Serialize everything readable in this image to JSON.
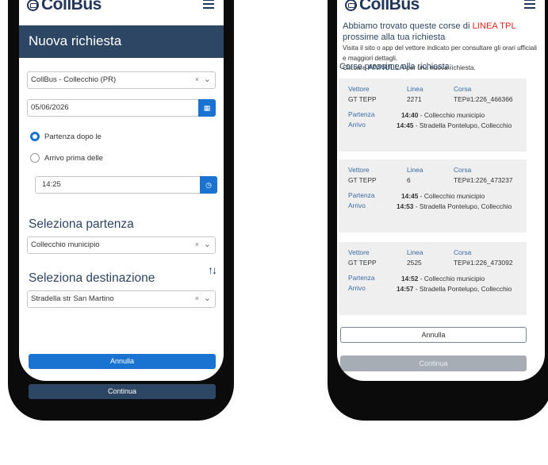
{
  "app": {
    "logo_text": "CollBus"
  },
  "left": {
    "title": "Nuova richiesta",
    "area_select": "CollBus - Collecchio (PR)",
    "date_value": "05/06/2026",
    "radio_departure": "Partenza dopo le",
    "radio_arrival": "Arrivo prima delle",
    "selected_radio": "departure",
    "time_value": "14:25",
    "departure_title": "Seleziona partenza",
    "departure_value": "Collecchio municipio",
    "destination_title": "Seleziona destinazione",
    "destination_value": "Stradella str San Martino",
    "cancel_label": "Annulla",
    "continue_label": "Continua",
    "clear_glyph": "×",
    "swap_glyph": "↑↓"
  },
  "right": {
    "notice_line1": "Abbiamo trovato queste corse di ",
    "notice_red": "LINEA TPL",
    "notice_line2": " prossime alla tua richiesta",
    "notice_small1": "Visita il sito o app del vettore indicato per consultare gli orari ufficiali e maggiori dettagli.",
    "notice_small2_pre": "Cliccare ",
    "notice_small2_annulla": "ANNULLA",
    "notice_small2_post": " per una nuova richiesta.",
    "results_title": "Corse prossime alla richiesta:",
    "labels": {
      "vettore": "Vettore",
      "linea": "Linea",
      "corsa": "Corsa",
      "partenza": "Partenza",
      "arrivo": "Arrivo"
    },
    "results": [
      {
        "vettore": "GT TEPP",
        "linea": "2271",
        "corsa": "TEP#1:226_466366",
        "dep_time": "14:40",
        "dep_stop": " - Collecchio municipio",
        "arr_time": "14:45",
        "arr_stop": " - Stradella Pontelupo, Collecchio"
      },
      {
        "vettore": "GT TEPP",
        "linea": "6",
        "corsa": "TEP#1:226_473237",
        "dep_time": "14:45",
        "dep_stop": " - Collecchio municipio",
        "arr_time": "14:53",
        "arr_stop": " - Stradella Pontelupo, Collecchio"
      },
      {
        "vettore": "GT TEPP",
        "linea": "2525",
        "corsa": "TEP#1:226_473092",
        "dep_time": "14:52",
        "dep_stop": " - Collecchio municipio",
        "arr_time": "14:57",
        "arr_stop": " - Stradella Pontelupo, Collecchio"
      }
    ],
    "cancel_label": "Annulla",
    "continue_label": "Continua"
  },
  "icons": {
    "logo": "bus-icon",
    "menu": "hamburger-menu-icon",
    "calendar": "calendar-icon",
    "clock": "clock-icon",
    "chevron": "chevron-down-icon",
    "swap": "swap-arrows-icon"
  },
  "colors": {
    "primary": "#2d4663",
    "accent": "#1a73d0",
    "alert": "#e0261c",
    "disabled": "#a7adb4"
  }
}
